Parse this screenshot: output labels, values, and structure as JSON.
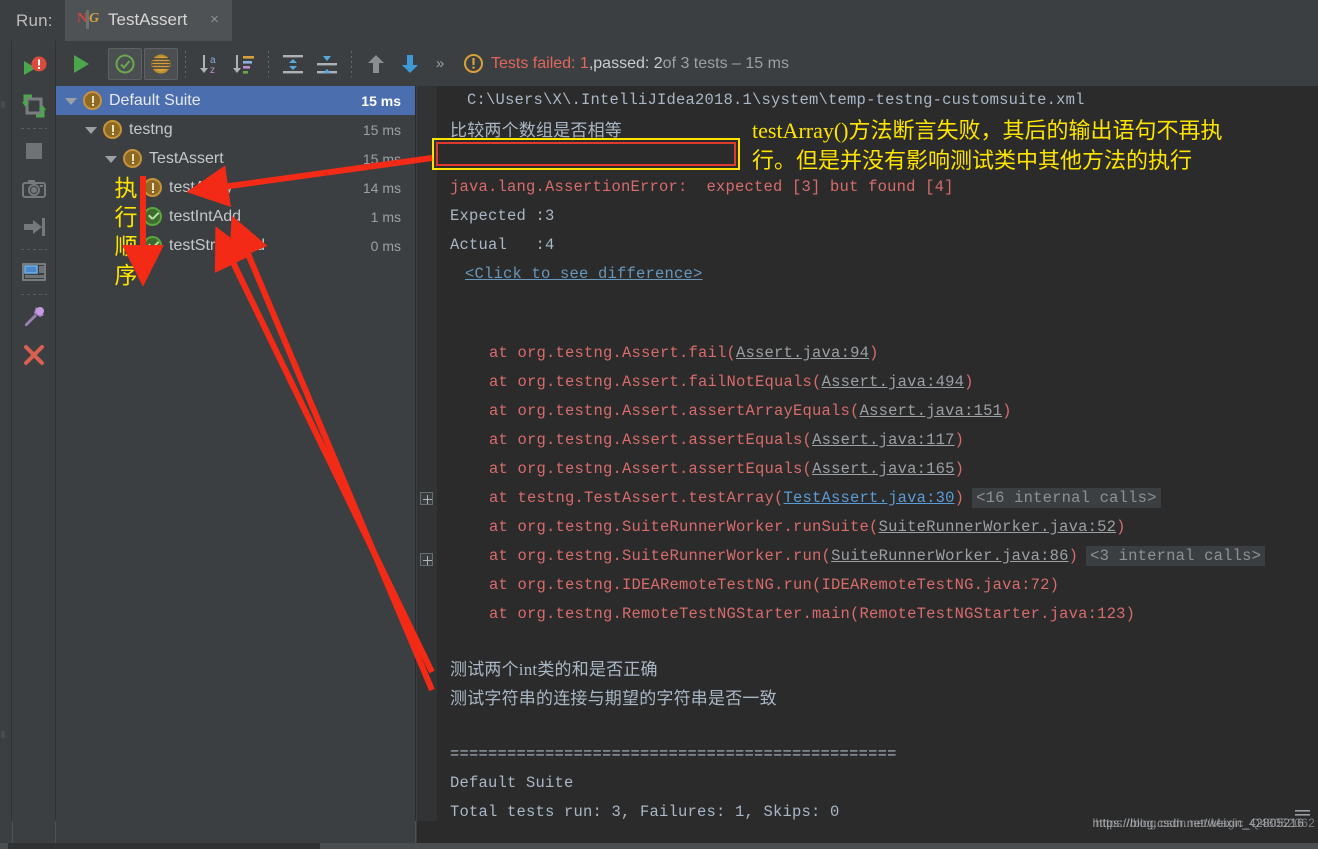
{
  "window": {
    "run_label": "Run:",
    "tab": {
      "title": "TestAssert",
      "icon": "testng-icon",
      "close": "×",
      "n": "N",
      "g": "G"
    }
  },
  "toolbar": {
    "buttons": [
      {
        "name": "rerun-button",
        "icon": "play-icon",
        "label": "Rerun"
      },
      {
        "name": "toggle-show-passed",
        "icon": "check-circle-icon",
        "label": "Show Passed"
      },
      {
        "name": "toggle-show-ignored",
        "icon": "striped-circle-icon",
        "label": "Show Ignored"
      },
      {
        "name": "sort-alphabetically-button",
        "icon": "sort-alpha-icon",
        "label": "Sort Alphabetically"
      },
      {
        "name": "sort-by-duration-button",
        "icon": "sort-duration-icon",
        "label": "Sort by Duration"
      },
      {
        "name": "expand-all-button",
        "icon": "expand-all-icon",
        "label": "Expand All"
      },
      {
        "name": "collapse-all-button",
        "icon": "collapse-all-icon",
        "label": "Collapse All"
      },
      {
        "name": "prev-failed-button",
        "icon": "arrow-up-icon",
        "label": "Previous Failed Test"
      },
      {
        "name": "next-failed-button",
        "icon": "arrow-down-icon",
        "label": "Next Failed Test"
      },
      {
        "name": "more-button",
        "icon": "chevron-double-right-icon",
        "label": "»"
      }
    ],
    "status": {
      "icon": "warning-circle-icon",
      "failed": "Tests failed: 1",
      "comma": ", ",
      "passed": "passed: 2",
      "rest": " of 3 tests – 15 ms"
    }
  },
  "sidebar": {
    "items": [
      {
        "name": "rerun-failed-tests-button",
        "icon": "rerun-failed-icon",
        "label": "Rerun Failed Tests"
      },
      {
        "name": "toggle-auto-test-button",
        "icon": "auto-test-icon",
        "label": "Toggle auto-test"
      },
      {
        "name": "stop-button",
        "icon": "stop-square-icon",
        "label": "Stop"
      },
      {
        "name": "export-snapshot-button",
        "icon": "camera-icon",
        "label": "Export Test Results"
      },
      {
        "name": "import-results-button",
        "icon": "import-arrow-icon",
        "label": "Import Test Results"
      },
      {
        "name": "layout-settings-button",
        "icon": "layout-icon",
        "label": "Layout Settings"
      },
      {
        "name": "pin-tab-button",
        "icon": "pushpin-icon",
        "label": "Pin Tab"
      },
      {
        "name": "close-button",
        "icon": "close-x-icon",
        "label": "Close"
      }
    ]
  },
  "tree": {
    "rows": [
      {
        "name": "tree-row-default-suite",
        "label": "Default Suite",
        "time": "15 ms",
        "status": "warn",
        "indent": 0,
        "arrow": true,
        "selected": true
      },
      {
        "name": "tree-row-testng",
        "label": "testng",
        "time": "15 ms",
        "status": "warn",
        "indent": 1,
        "arrow": true,
        "selected": false
      },
      {
        "name": "tree-row-testassert",
        "label": "TestAssert",
        "time": "15 ms",
        "status": "warn",
        "indent": 2,
        "arrow": true,
        "selected": false
      },
      {
        "name": "tree-row-testarray",
        "label": "testArray",
        "time": "14 ms",
        "status": "warn",
        "indent": 3,
        "arrow": false,
        "selected": false
      },
      {
        "name": "tree-row-testintadd",
        "label": "testIntAdd",
        "time": "1 ms",
        "status": "ok",
        "indent": 3,
        "arrow": false,
        "selected": false
      },
      {
        "name": "tree-row-teststringadd",
        "label": "testStringAdd",
        "time": "0 ms",
        "status": "ok",
        "indent": 3,
        "arrow": false,
        "selected": false
      }
    ]
  },
  "console": {
    "path_line": "C:\\Users\\X\\.IntelliJIdea2018.1\\system\\temp-testng-customsuite.xml",
    "cjk_line_1": "比较两个数组是否相等",
    "assertion_error": "java.lang.AssertionError:  expected [3] but found [4]",
    "expected": "Expected :3",
    "actual": "Actual   :4",
    "click_diff": "<Click to see difference>",
    "stack": [
      {
        "prefix": "at org.testng.Assert.fail(",
        "link": "Assert.java:94",
        "suffix": ")",
        "blue": false,
        "expander": false,
        "internal": ""
      },
      {
        "prefix": "at org.testng.Assert.failNotEquals(",
        "link": "Assert.java:494",
        "suffix": ")",
        "blue": false,
        "expander": false,
        "internal": ""
      },
      {
        "prefix": "at org.testng.Assert.assertArrayEquals(",
        "link": "Assert.java:151",
        "suffix": ")",
        "blue": false,
        "expander": false,
        "internal": ""
      },
      {
        "prefix": "at org.testng.Assert.assertEquals(",
        "link": "Assert.java:117",
        "suffix": ")",
        "blue": false,
        "expander": false,
        "internal": ""
      },
      {
        "prefix": "at org.testng.Assert.assertEquals(",
        "link": "Assert.java:165",
        "suffix": ")",
        "blue": false,
        "expander": false,
        "internal": ""
      },
      {
        "prefix": "at testng.TestAssert.testArray(",
        "link": "TestAssert.java:30",
        "suffix": ")",
        "blue": true,
        "expander": true,
        "internal": "<16 internal calls>"
      },
      {
        "prefix": "at org.testng.SuiteRunnerWorker.runSuite(",
        "link": "SuiteRunnerWorker.java:52",
        "suffix": ")",
        "blue": false,
        "expander": false,
        "internal": ""
      },
      {
        "prefix": "at org.testng.SuiteRunnerWorker.run(",
        "link": "SuiteRunnerWorker.java:86",
        "suffix": ")",
        "blue": false,
        "expander": true,
        "internal": "<3 internal calls>"
      },
      {
        "prefix": "at org.testng.IDEARemoteTestNG.run(IDEARemoteTestNG.java:72)",
        "link": "",
        "suffix": "",
        "blue": false,
        "expander": false,
        "internal": ""
      },
      {
        "prefix": "at org.testng.RemoteTestNGStarter.main(RemoteTestNGStarter.java:123)",
        "link": "",
        "suffix": "",
        "blue": false,
        "expander": false,
        "internal": ""
      }
    ],
    "cjk_line_2": "测试两个int类的和是否正确",
    "cjk_line_3": "测试字符串的连接与期望的字符串是否一致",
    "rule_top": "===============================================",
    "summary_title": "Default Suite",
    "summary_line": "Total tests run: 3, Failures: 1, Skips: 0",
    "rule_bottom": "==============================================="
  },
  "annotations": {
    "yellow_line_1": "testArray()方法断言失败，其后的输出语句不再执",
    "yellow_line_2": "行。但是并没有影响测试类中其他方法的执行",
    "vertical_text": "执行顺序",
    "box_label": "empty-output-highlight"
  },
  "watermark": {
    "text": "https://blog.csdn.net/weixin_42805216",
    "overlay": "https://blog.csdn.net/Magic_Q48052062"
  },
  "colors": {
    "background": "#3c3f41",
    "console_bg": "#2b2b2b",
    "selection": "#4b6eaf",
    "fail_red": "#e0685b",
    "pass_green": "#59a83c",
    "warn_orange": "#c8923a",
    "annotation_yellow": "#ffe400",
    "annotation_red": "#e03a2f",
    "link_blue": "#6897bb"
  }
}
